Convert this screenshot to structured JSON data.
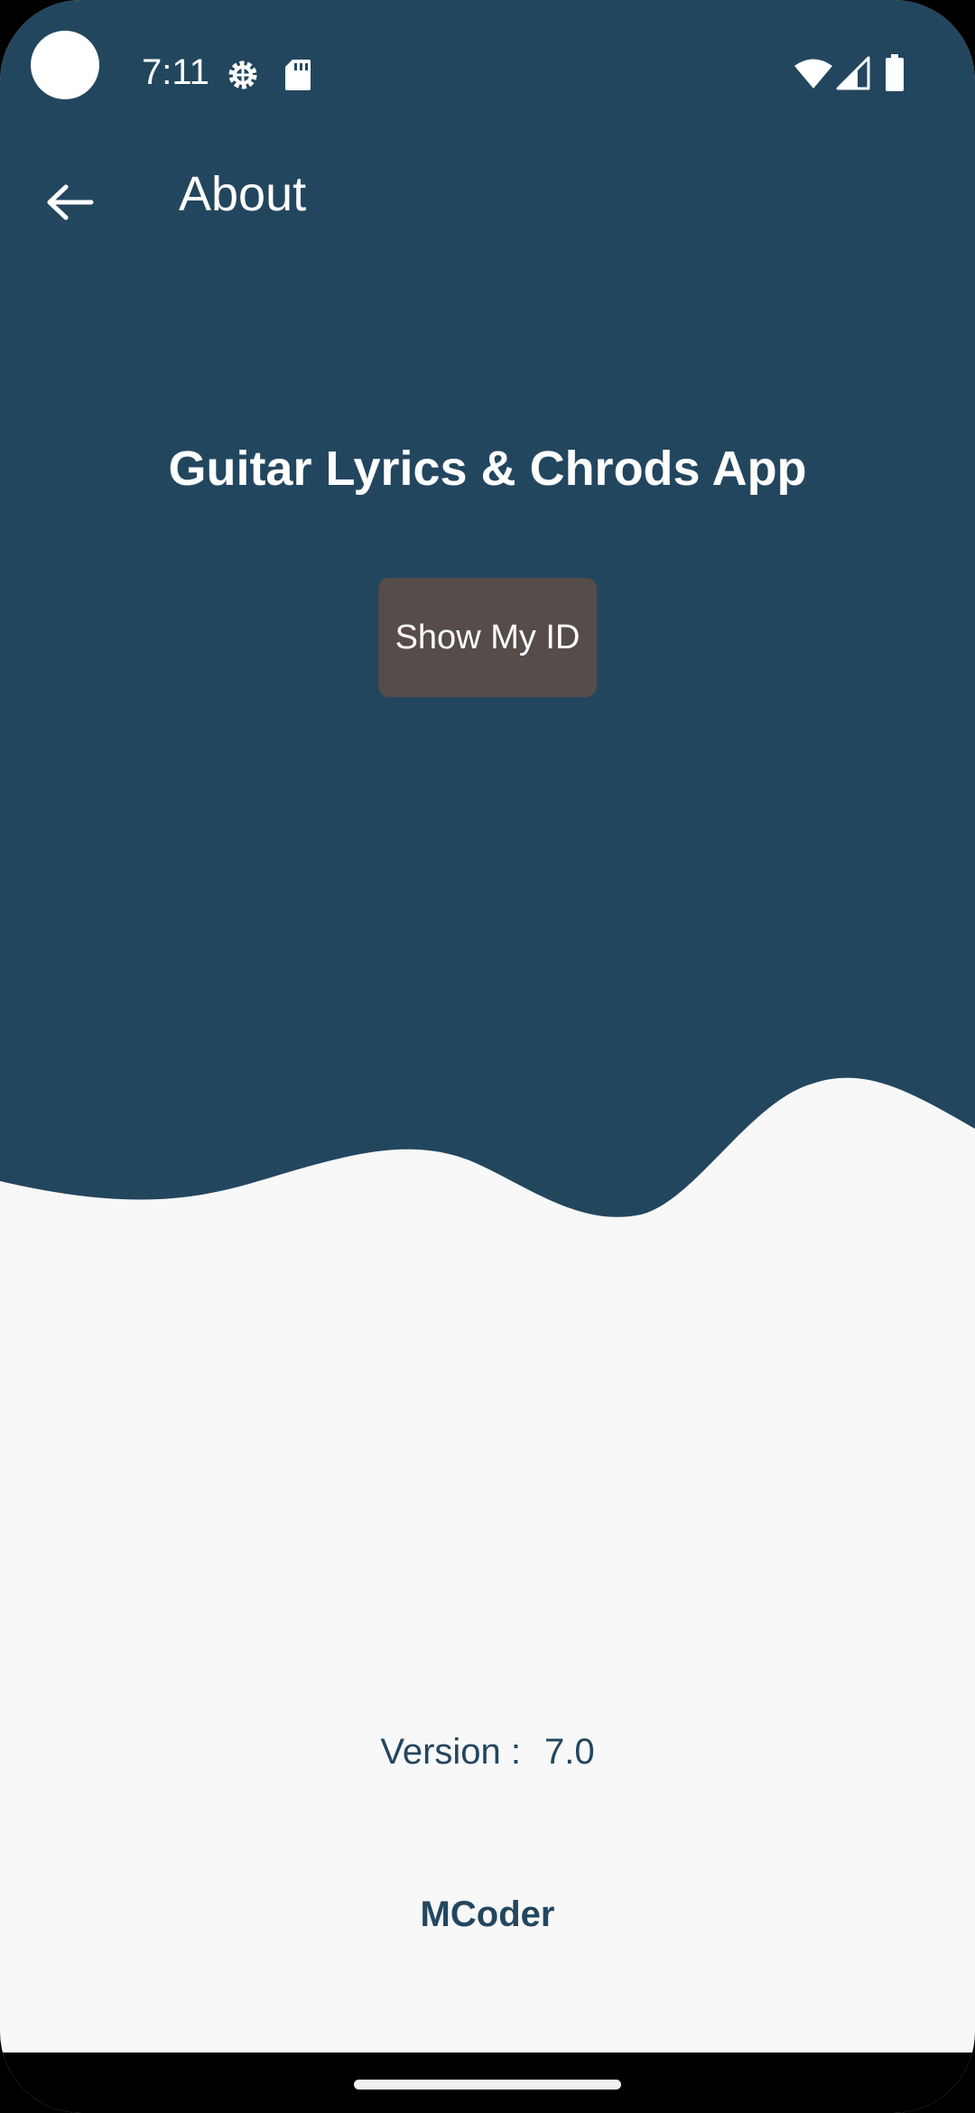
{
  "colors": {
    "header_bg": "#23465f",
    "body_bg": "#f8f8f8",
    "button_bg": "#564c49",
    "accent_text": "#23465f"
  },
  "status_bar": {
    "time": "7:11",
    "icons": [
      "settings-gear-icon",
      "sd-card-icon",
      "wifi-icon",
      "cellular-signal-icon",
      "battery-icon"
    ]
  },
  "app_bar": {
    "title": "About",
    "back_icon": "arrow-back-icon"
  },
  "main": {
    "app_name": "Guitar Lyrics & Chrods App",
    "show_id_button": "Show My ID",
    "version_label": "Version :",
    "version_value": "7.0",
    "developer": "MCoder"
  }
}
